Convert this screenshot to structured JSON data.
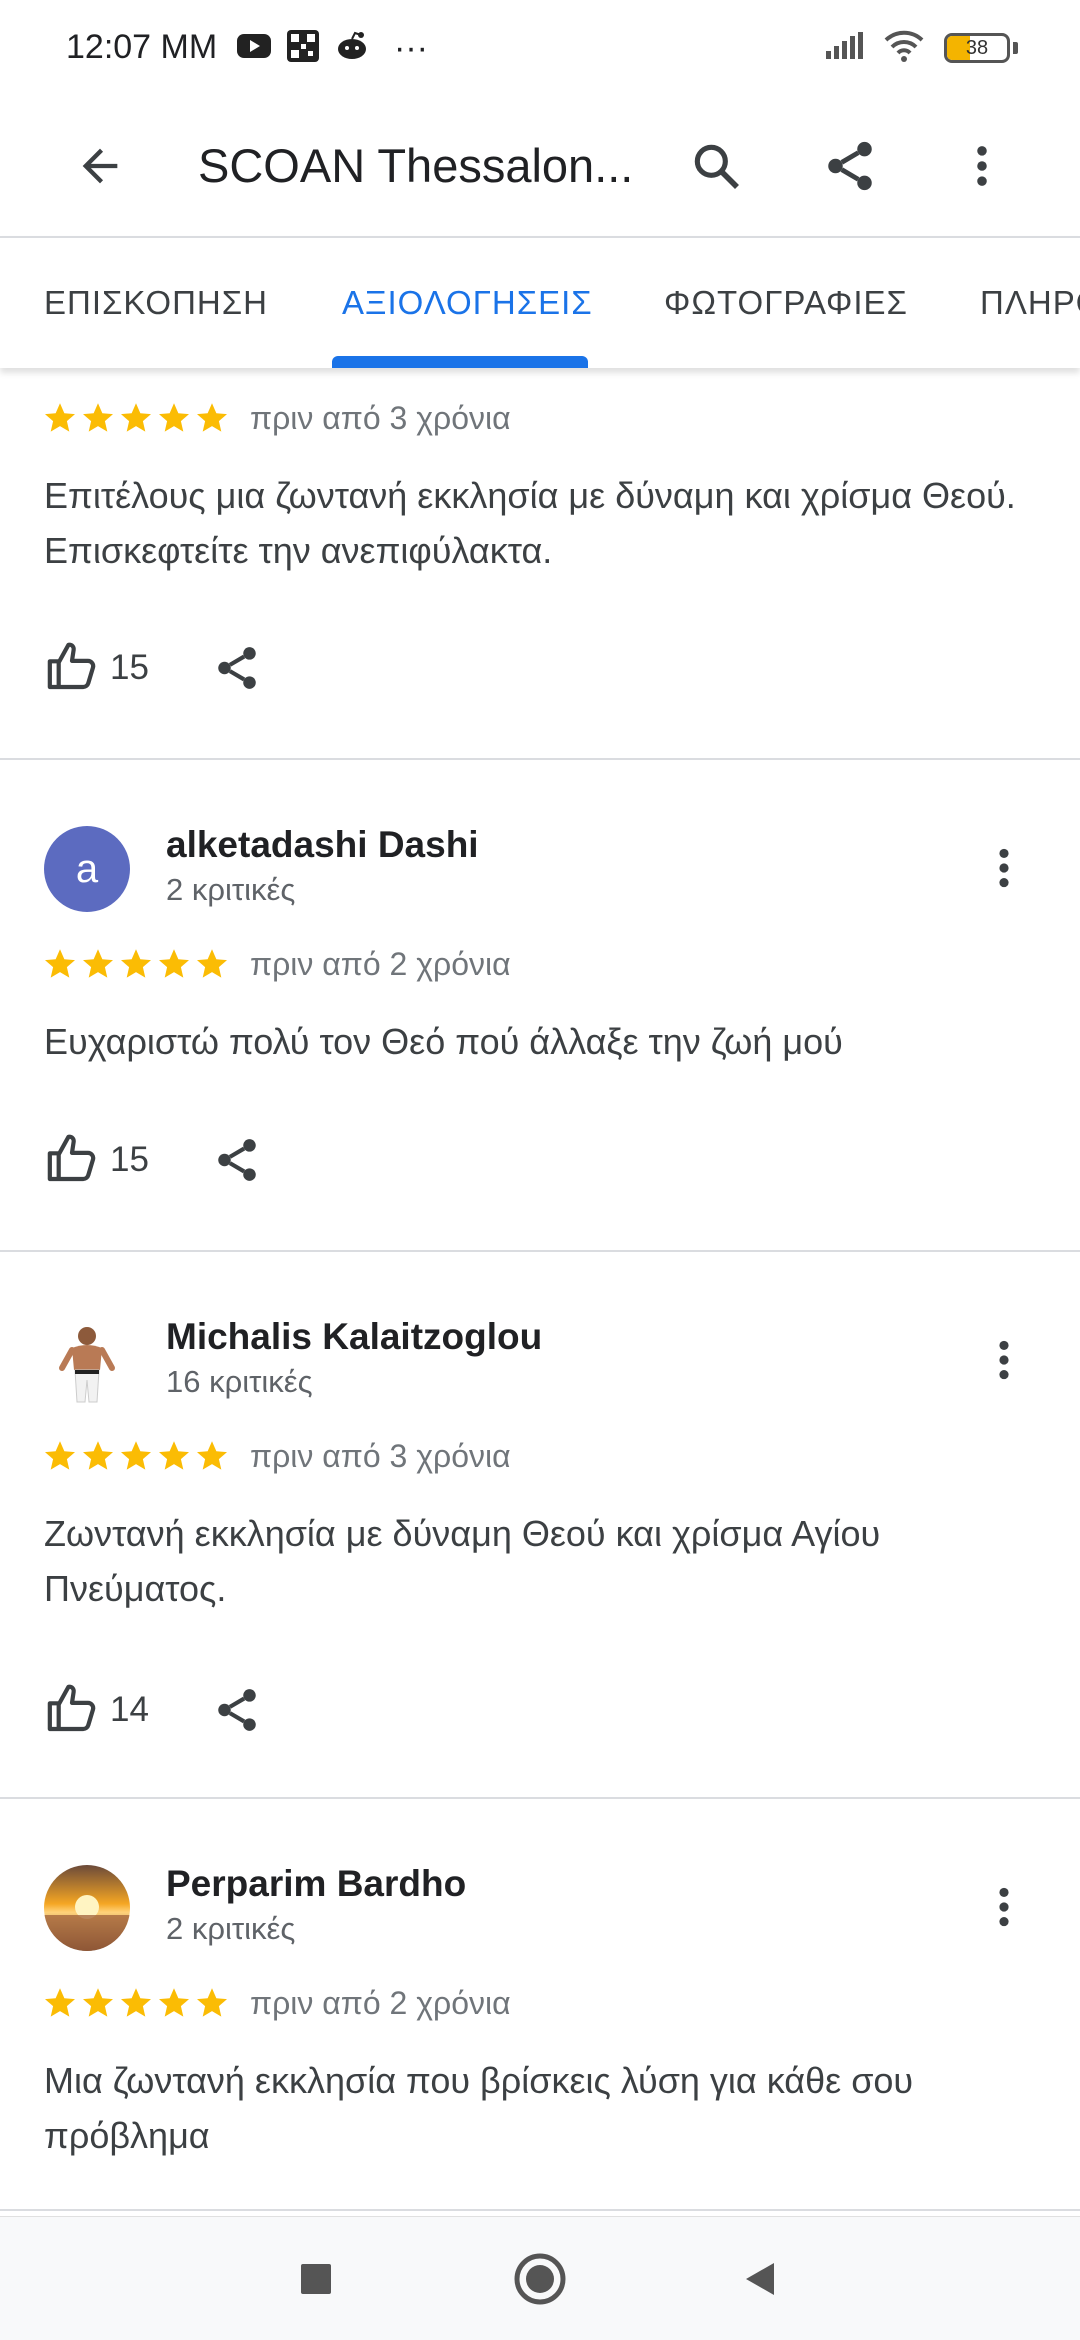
{
  "status_bar": {
    "time": "12:07 ΜΜ",
    "overflow": "···",
    "battery_level": "38",
    "battery_fraction": 0.38,
    "icons": [
      "youtube-icon",
      "qr-app-icon",
      "reddit-icon",
      "signal-icon",
      "wifi-icon",
      "battery-icon"
    ]
  },
  "app_bar": {
    "title": "SCOAN Thessalon...",
    "icons": [
      "back-arrow-icon",
      "search-icon",
      "share-icon",
      "more-vert-icon"
    ]
  },
  "tabs": [
    {
      "label": "ΕΠΙΣΚΟΠΗΣΗ",
      "active": false
    },
    {
      "label": "ΑΞΙΟΛΟΓΗΣΕΙΣ",
      "active": true
    },
    {
      "label": "ΦΩΤΟΓΡΑΦΙΕΣ",
      "active": false
    },
    {
      "label": "ΠΛΗΡΟ",
      "active": false
    }
  ],
  "colors": {
    "accent": "#1a73e8",
    "star": "#fbbc04",
    "avatar_letter_bg": "#5c6bc0"
  },
  "reviews": [
    {
      "rating": 5,
      "time_ago": "πριν από 3 χρόνια",
      "text": "Επιτέλους μια ζωντανή εκκλησία με δύναμη και χρίσμα Θεού. Επισκεφτείτε την ανεπιφύλακτα.",
      "likes": "15"
    },
    {
      "author": "alketadashi Dashi",
      "review_count": "2 κριτικές",
      "avatar_letter": "a",
      "rating": 5,
      "time_ago": "πριν από 2 χρόνια",
      "text": "Ευχαριστώ πολύ τον Θεό πού άλλαξε την ζωή μού",
      "likes": "15"
    },
    {
      "author": "Michalis Kalaitzoglou",
      "review_count": "16 κριτικές",
      "rating": 5,
      "time_ago": "πριν από 3 χρόνια",
      "text": "Ζωντανή εκκλησία με δύναμη Θεού και χρίσμα Αγίου Πνεύματος.",
      "likes": "14"
    },
    {
      "author": "Perparim Bardho",
      "review_count": "2 κριτικές",
      "rating": 5,
      "time_ago": "πριν από 2 χρόνια",
      "text": "Μια ζωντανή εκκλησία που βρίσκεις λύση για κάθε σου πρόβλημα"
    }
  ],
  "nav_bar": {
    "icons": [
      "recents-square-icon",
      "home-circle-icon",
      "back-triangle-icon"
    ]
  }
}
